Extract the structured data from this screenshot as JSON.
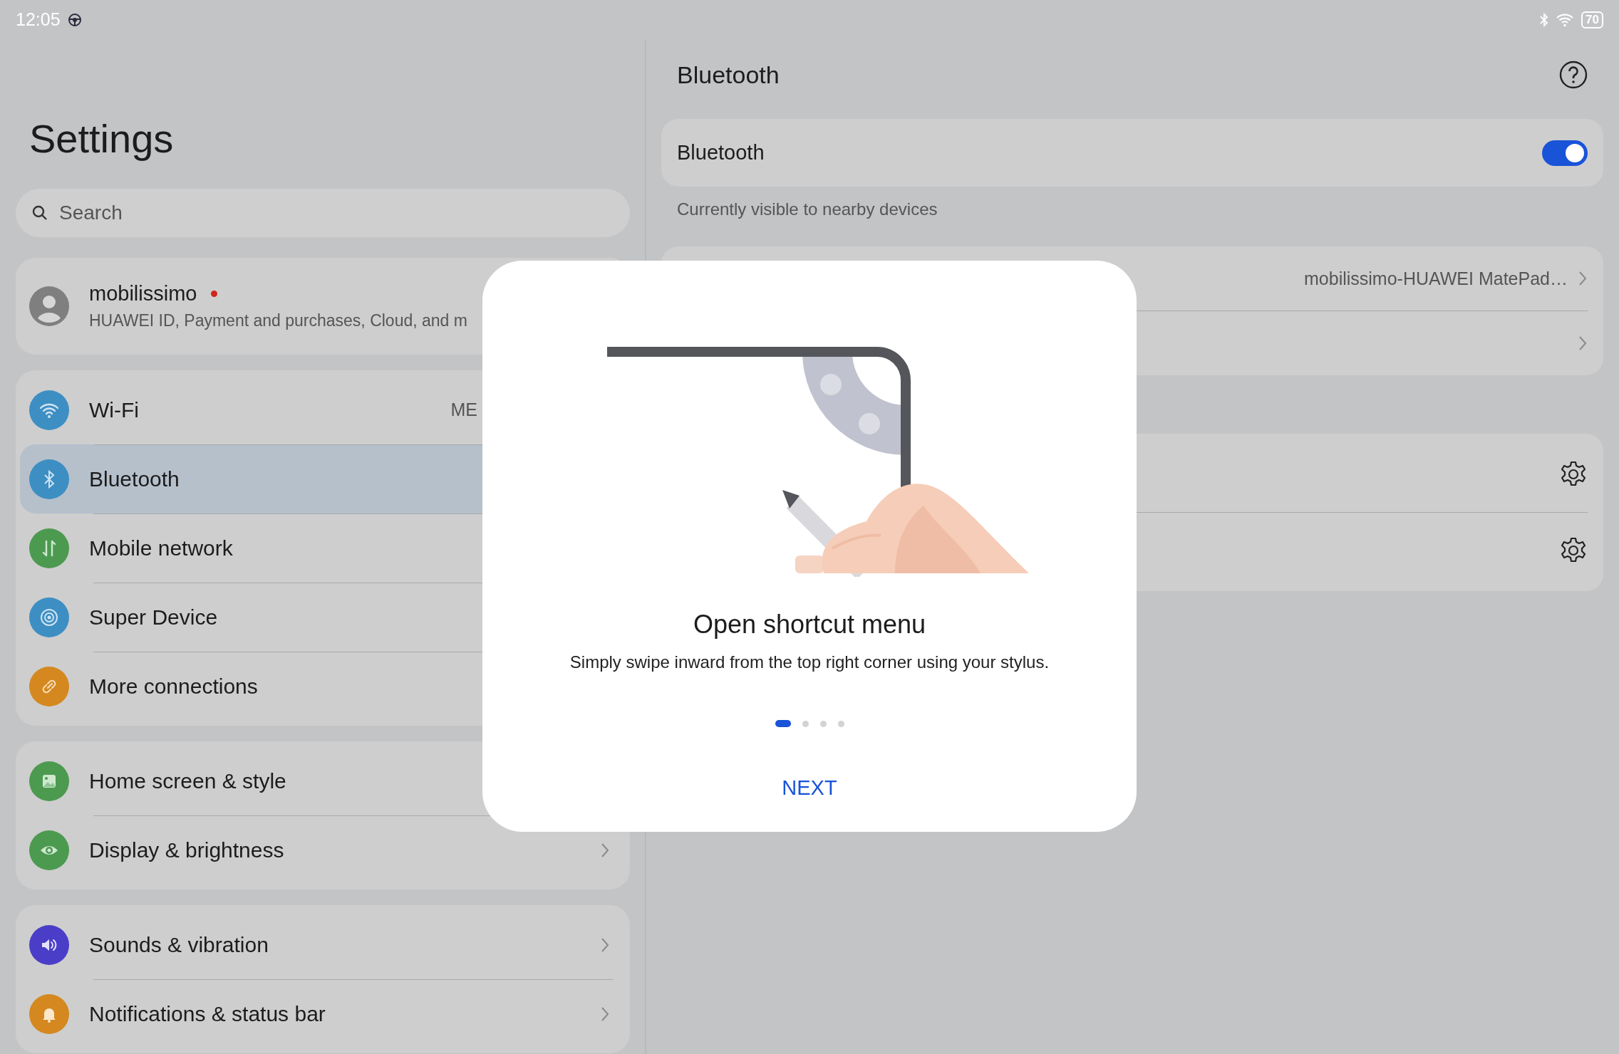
{
  "status_bar": {
    "time": "12:05",
    "battery": "70"
  },
  "settings_pane": {
    "title": "Settings",
    "search": {
      "placeholder": "Search"
    },
    "account": {
      "name": "mobilissimo",
      "notification_dot": true,
      "subtitle": "HUAWEI ID, Payment and purchases, Cloud, and m"
    },
    "groups": [
      {
        "items": [
          {
            "kind": "wifi",
            "label": "Wi-Fi",
            "value": "ME",
            "color": "#3d8fc3",
            "selected": false,
            "chevron": false
          },
          {
            "kind": "bluetooth",
            "label": "Bluetooth",
            "color": "#3d8fc3",
            "selected": true,
            "chevron": false
          },
          {
            "kind": "mobile",
            "label": "Mobile network",
            "color": "#4c9a50",
            "selected": false,
            "chevron": false
          },
          {
            "kind": "super",
            "label": "Super Device",
            "color": "#3d8fc3",
            "selected": false,
            "chevron": false
          },
          {
            "kind": "link",
            "label": "More connections",
            "color": "#d4881f",
            "selected": false,
            "chevron": false
          }
        ]
      },
      {
        "items": [
          {
            "kind": "image",
            "label": "Home screen & style",
            "color": "#4c9a50",
            "selected": false,
            "chevron": false
          },
          {
            "kind": "eye",
            "label": "Display & brightness",
            "color": "#4c9a50",
            "selected": false,
            "chevron": true
          }
        ]
      },
      {
        "items": [
          {
            "kind": "speaker",
            "label": "Sounds & vibration",
            "color": "#4a3ec8",
            "selected": false,
            "chevron": true
          },
          {
            "kind": "bell",
            "label": "Notifications & status bar",
            "color": "#d4881f",
            "selected": false,
            "chevron": true
          }
        ]
      }
    ]
  },
  "detail_pane": {
    "title": "Bluetooth",
    "toggle": {
      "label": "Bluetooth",
      "on": true
    },
    "caption": "Currently visible to nearby devices",
    "rows": [
      {
        "kind": "chevron",
        "value": "mobilissimo-HUAWEI MatePad…"
      },
      {
        "kind": "chevron"
      }
    ],
    "settings_rows": [
      {
        "kind": "gear"
      },
      {
        "kind": "gear"
      }
    ]
  },
  "dialog": {
    "title": "Open shortcut menu",
    "description": "Simply swipe inward from the top right corner using your stylus.",
    "pages": [
      {
        "selected": true
      },
      {
        "selected": false
      },
      {
        "selected": false
      },
      {
        "selected": false
      }
    ],
    "button": "NEXT"
  }
}
